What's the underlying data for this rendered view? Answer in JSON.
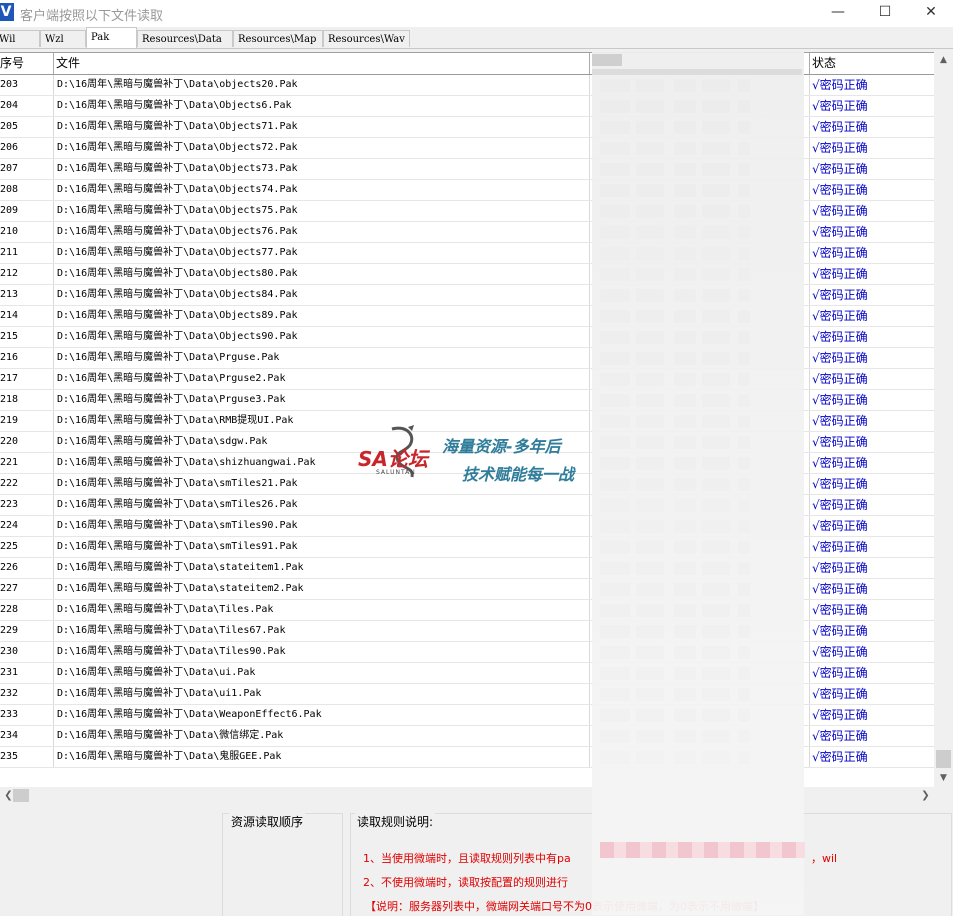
{
  "window": {
    "title": "客户端按照以下文件读取",
    "app_icon": "V"
  },
  "tabs": [
    {
      "label": "Wil",
      "active": false
    },
    {
      "label": "Wzl",
      "active": false
    },
    {
      "label": "Pak",
      "active": true
    },
    {
      "label": "Resources\\Data",
      "active": false
    },
    {
      "label": "Resources\\Map",
      "active": false
    },
    {
      "label": "Resources\\Wav",
      "active": false
    }
  ],
  "grid": {
    "columns": {
      "index": "序号",
      "file": "文件",
      "status": "状态"
    },
    "rows": [
      {
        "index": "203",
        "file": "D:\\16周年\\黑暗与魔兽补丁\\Data\\objects20.Pak",
        "status": "√密码正确"
      },
      {
        "index": "204",
        "file": "D:\\16周年\\黑暗与魔兽补丁\\Data\\Objects6.Pak",
        "status": "√密码正确"
      },
      {
        "index": "205",
        "file": "D:\\16周年\\黑暗与魔兽补丁\\Data\\Objects71.Pak",
        "status": "√密码正确"
      },
      {
        "index": "206",
        "file": "D:\\16周年\\黑暗与魔兽补丁\\Data\\Objects72.Pak",
        "status": "√密码正确"
      },
      {
        "index": "207",
        "file": "D:\\16周年\\黑暗与魔兽补丁\\Data\\Objects73.Pak",
        "status": "√密码正确"
      },
      {
        "index": "208",
        "file": "D:\\16周年\\黑暗与魔兽补丁\\Data\\Objects74.Pak",
        "status": "√密码正确"
      },
      {
        "index": "209",
        "file": "D:\\16周年\\黑暗与魔兽补丁\\Data\\Objects75.Pak",
        "status": "√密码正确"
      },
      {
        "index": "210",
        "file": "D:\\16周年\\黑暗与魔兽补丁\\Data\\Objects76.Pak",
        "status": "√密码正确"
      },
      {
        "index": "211",
        "file": "D:\\16周年\\黑暗与魔兽补丁\\Data\\Objects77.Pak",
        "status": "√密码正确"
      },
      {
        "index": "212",
        "file": "D:\\16周年\\黑暗与魔兽补丁\\Data\\Objects80.Pak",
        "status": "√密码正确"
      },
      {
        "index": "213",
        "file": "D:\\16周年\\黑暗与魔兽补丁\\Data\\Objects84.Pak",
        "status": "√密码正确"
      },
      {
        "index": "214",
        "file": "D:\\16周年\\黑暗与魔兽补丁\\Data\\Objects89.Pak",
        "status": "√密码正确"
      },
      {
        "index": "215",
        "file": "D:\\16周年\\黑暗与魔兽补丁\\Data\\Objects90.Pak",
        "status": "√密码正确"
      },
      {
        "index": "216",
        "file": "D:\\16周年\\黑暗与魔兽补丁\\Data\\Prguse.Pak",
        "status": "√密码正确"
      },
      {
        "index": "217",
        "file": "D:\\16周年\\黑暗与魔兽补丁\\Data\\Prguse2.Pak",
        "status": "√密码正确"
      },
      {
        "index": "218",
        "file": "D:\\16周年\\黑暗与魔兽补丁\\Data\\Prguse3.Pak",
        "status": "√密码正确"
      },
      {
        "index": "219",
        "file": "D:\\16周年\\黑暗与魔兽补丁\\Data\\RMB提现UI.Pak",
        "status": "√密码正确"
      },
      {
        "index": "220",
        "file": "D:\\16周年\\黑暗与魔兽补丁\\Data\\sdgw.Pak",
        "status": "√密码正确"
      },
      {
        "index": "221",
        "file": "D:\\16周年\\黑暗与魔兽补丁\\Data\\shizhuangwai.Pak",
        "status": "√密码正确"
      },
      {
        "index": "222",
        "file": "D:\\16周年\\黑暗与魔兽补丁\\Data\\smTiles21.Pak",
        "status": "√密码正确"
      },
      {
        "index": "223",
        "file": "D:\\16周年\\黑暗与魔兽补丁\\Data\\smTiles26.Pak",
        "status": "√密码正确"
      },
      {
        "index": "224",
        "file": "D:\\16周年\\黑暗与魔兽补丁\\Data\\smTiles90.Pak",
        "status": "√密码正确"
      },
      {
        "index": "225",
        "file": "D:\\16周年\\黑暗与魔兽补丁\\Data\\smTiles91.Pak",
        "status": "√密码正确"
      },
      {
        "index": "226",
        "file": "D:\\16周年\\黑暗与魔兽补丁\\Data\\stateitem1.Pak",
        "status": "√密码正确"
      },
      {
        "index": "227",
        "file": "D:\\16周年\\黑暗与魔兽补丁\\Data\\stateitem2.Pak",
        "status": "√密码正确"
      },
      {
        "index": "228",
        "file": "D:\\16周年\\黑暗与魔兽补丁\\Data\\Tiles.Pak",
        "status": "√密码正确"
      },
      {
        "index": "229",
        "file": "D:\\16周年\\黑暗与魔兽补丁\\Data\\Tiles67.Pak",
        "status": "√密码正确"
      },
      {
        "index": "230",
        "file": "D:\\16周年\\黑暗与魔兽补丁\\Data\\Tiles90.Pak",
        "status": "√密码正确"
      },
      {
        "index": "231",
        "file": "D:\\16周年\\黑暗与魔兽补丁\\Data\\ui.Pak",
        "status": "√密码正确"
      },
      {
        "index": "232",
        "file": "D:\\16周年\\黑暗与魔兽补丁\\Data\\ui1.Pak",
        "status": "√密码正确"
      },
      {
        "index": "233",
        "file": "D:\\16周年\\黑暗与魔兽补丁\\Data\\WeaponEffect6.Pak",
        "status": "√密码正确"
      },
      {
        "index": "234",
        "file": "D:\\16周年\\黑暗与魔兽补丁\\Data\\微信绑定.Pak",
        "status": "√密码正确"
      },
      {
        "index": "235",
        "file": "D:\\16周年\\黑暗与魔兽补丁\\Data\\鬼服GEE.Pak",
        "status": "√密码正确"
      }
    ]
  },
  "panels": {
    "order_title": "资源读取顺序",
    "rules_title": "读取规则说明:",
    "rules": [
      "1、当使用微端时，且读取规则列表中有pa",
      "，wil",
      "2、不使用微端时，读取按配置的规则进行",
      "【说明：服务器列表中，微端网关端口号不为0表示使用微端，为0表示不用微端】"
    ]
  },
  "watermark": {
    "logo": "SA论坛",
    "sub": "SALUNTAN",
    "line1": "海量资源-多年后",
    "line2": "技术赋能每一战"
  },
  "colors": {
    "status_text": "#0000c8",
    "rule_text": "#e00000",
    "app_icon_bg": "#1e57b8"
  }
}
